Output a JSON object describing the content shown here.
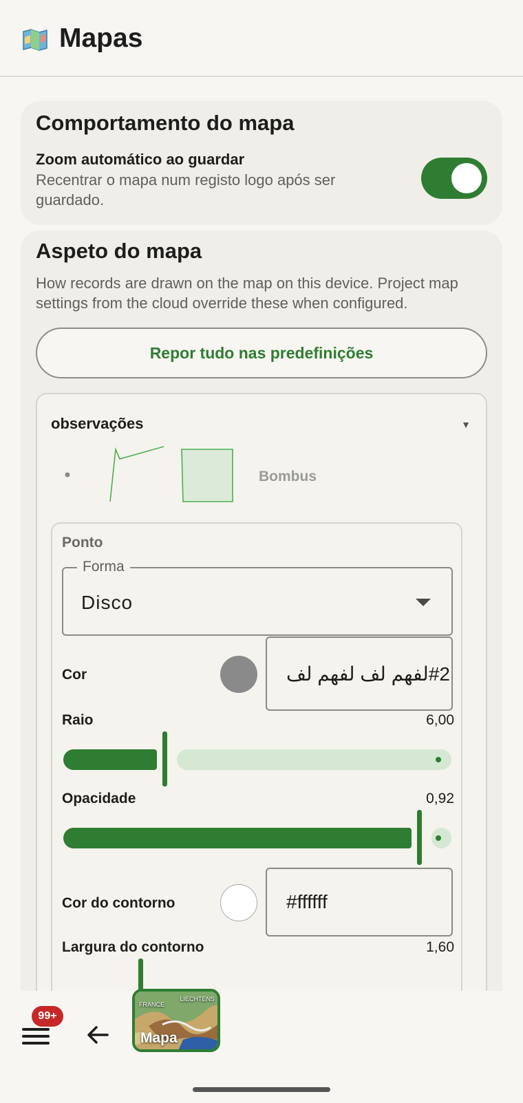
{
  "appbar": {
    "title": "Mapas",
    "icon": "map-icon"
  },
  "behavior_card": {
    "title": "Comportamento do mapa",
    "auto_zoom_label": "Zoom automático ao guardar",
    "auto_zoom_description": "Recentrar o mapa num registo logo após ser guardado.",
    "auto_zoom_enabled": true
  },
  "appearance_card": {
    "title": "Aspeto do mapa",
    "description": "How records are drawn on the map on this device. Project map settings from the cloud override these when configured.",
    "reset_label": "Repor tudo nas predefinições"
  },
  "layer": {
    "name": "observações",
    "preview_label": "Bombus",
    "point": {
      "title": "Ponto",
      "shape_legend": "Forma",
      "shape_value": "Disco",
      "color_label": "Cor",
      "color_value": "#2لفهم لف لفهم لف",
      "color_swatch": "#8a8a8a",
      "radius_label": "Raio",
      "radius_value": "6,00",
      "radius_fraction": 0.26,
      "opacity_label": "Opacidade",
      "opacity_value": "0,92",
      "opacity_fraction": 0.92,
      "stroke_color_label": "Cor do contorno",
      "stroke_color_value": "#ffffff",
      "stroke_color_swatch": "#ffffff",
      "stroke_width_label": "Largura do contorno",
      "stroke_width_value": "1,60"
    }
  },
  "bottom_bar": {
    "badge": "99+",
    "map_tile_label": "Mapa",
    "map_tile_caption_left": "FRANCE",
    "map_tile_caption_right": "LIECHTENS"
  },
  "colors": {
    "accent": "#2e7d32",
    "accent_light": "#d5e8d4",
    "badge": "#c62828"
  }
}
